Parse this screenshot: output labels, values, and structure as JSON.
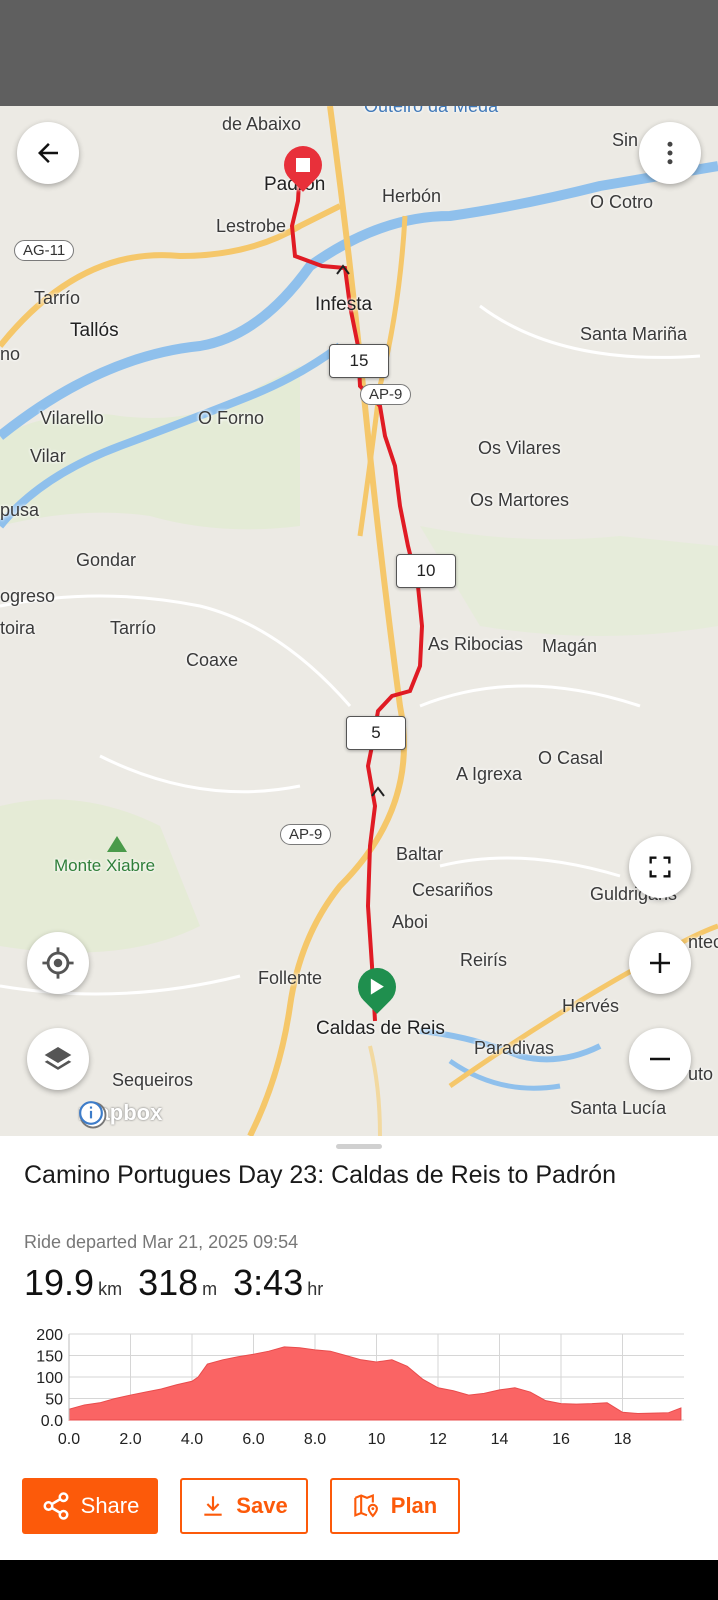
{
  "map": {
    "places": [
      {
        "key": "de-abaixo",
        "name": "de Abaixo"
      },
      {
        "key": "outeiro",
        "name": "Outeiro da Meda"
      },
      {
        "key": "sin",
        "name": "Sin"
      },
      {
        "key": "padron",
        "name": "Padrón"
      },
      {
        "key": "herbon",
        "name": "Herbón"
      },
      {
        "key": "o-cotro",
        "name": "O Cotro"
      },
      {
        "key": "lestrobe",
        "name": "Lestrobe"
      },
      {
        "key": "tarrio",
        "name": "Tarrío"
      },
      {
        "key": "tallos",
        "name": "Tallós"
      },
      {
        "key": "infesta",
        "name": "Infesta"
      },
      {
        "key": "santa-marina",
        "name": "Santa Mariña"
      },
      {
        "key": "no",
        "name": "no"
      },
      {
        "key": "vilarello",
        "name": "Vilarello"
      },
      {
        "key": "o-forno",
        "name": "O Forno"
      },
      {
        "key": "os-vilares",
        "name": "Os Vilares"
      },
      {
        "key": "vilar",
        "name": "Vilar"
      },
      {
        "key": "os-martores",
        "name": "Os Martores"
      },
      {
        "key": "pusa",
        "name": "pusa"
      },
      {
        "key": "gondar",
        "name": "Gondar"
      },
      {
        "key": "ogreso",
        "name": "ogreso"
      },
      {
        "key": "toira",
        "name": "toira"
      },
      {
        "key": "tarrio2",
        "name": "Tarrío"
      },
      {
        "key": "coaxe",
        "name": "Coaxe"
      },
      {
        "key": "as-ribocias",
        "name": "As Ribocias"
      },
      {
        "key": "magan",
        "name": "Magán"
      },
      {
        "key": "a-igrexa",
        "name": "A Igrexa"
      },
      {
        "key": "o-casal",
        "name": "O Casal"
      },
      {
        "key": "baltar",
        "name": "Baltar"
      },
      {
        "key": "cesarinos",
        "name": "Cesariños"
      },
      {
        "key": "guldrigans",
        "name": "Guldrigans"
      },
      {
        "key": "aboi",
        "name": "Aboi"
      },
      {
        "key": "reiris",
        "name": "Reirís"
      },
      {
        "key": "follente",
        "name": "Follente"
      },
      {
        "key": "herves",
        "name": "Hervés"
      },
      {
        "key": "caldas",
        "name": "Caldas de Reis"
      },
      {
        "key": "paradivas",
        "name": "Paradivas"
      },
      {
        "key": "sequeiros",
        "name": "Sequeiros"
      },
      {
        "key": "santa-lucia",
        "name": "Santa Lucía"
      },
      {
        "key": "uto",
        "name": "uto"
      },
      {
        "key": "ntec",
        "name": "ntec"
      }
    ],
    "peak": "Monte Xiabre",
    "roads": {
      "ag11": "AG-11",
      "ap9_north": "AP-9",
      "ap9_south": "AP-9"
    },
    "km_markers": {
      "m15": "15",
      "m10": "10",
      "m5": "5"
    },
    "attribution": "mapbox",
    "colors": {
      "route": "#e01b24",
      "start": "#1f8f4e",
      "end": "#e8303a"
    }
  },
  "activity": {
    "title": "Camino Portugues Day 23: Caldas de Reis to Padrón",
    "subtitle": "Ride departed Mar 21, 2025 09:54",
    "stats": [
      {
        "value": "19.9",
        "unit": "km"
      },
      {
        "value": "318",
        "unit": "m"
      },
      {
        "value": "3:43",
        "unit": "hr"
      }
    ]
  },
  "chart_data": {
    "type": "area",
    "x": [
      0,
      0.5,
      1,
      1.5,
      2,
      2.5,
      3,
      3.5,
      4,
      4.2,
      4.5,
      5,
      5.5,
      6,
      6.5,
      7,
      7.5,
      8,
      8.5,
      9,
      9.5,
      10,
      10.5,
      11,
      11.5,
      12,
      12.5,
      13,
      13.5,
      14,
      14.5,
      15,
      15.5,
      16,
      16.5,
      17,
      17.5,
      18,
      18.5,
      19,
      19.5,
      19.9
    ],
    "values": [
      25,
      35,
      40,
      50,
      58,
      65,
      72,
      82,
      90,
      100,
      130,
      140,
      147,
      153,
      160,
      170,
      168,
      163,
      160,
      150,
      140,
      135,
      140,
      125,
      95,
      75,
      68,
      58,
      62,
      70,
      75,
      65,
      45,
      38,
      37,
      38,
      40,
      18,
      15,
      16,
      17,
      28
    ],
    "xlabel": "",
    "ylabel": "",
    "xticks": [
      "0.0",
      "2.0",
      "4.0",
      "6.0",
      "8.0",
      "10",
      "12",
      "14",
      "16",
      "18"
    ],
    "yticks": [
      "0.0",
      "50",
      "100",
      "150",
      "200"
    ],
    "xlim": [
      0,
      20
    ],
    "ylim": [
      0,
      200
    ],
    "grid": true,
    "color": "#fa6464"
  },
  "actions": {
    "share": "Share",
    "save": "Save",
    "plan": "Plan"
  },
  "brand_color": "#fc5a0a"
}
